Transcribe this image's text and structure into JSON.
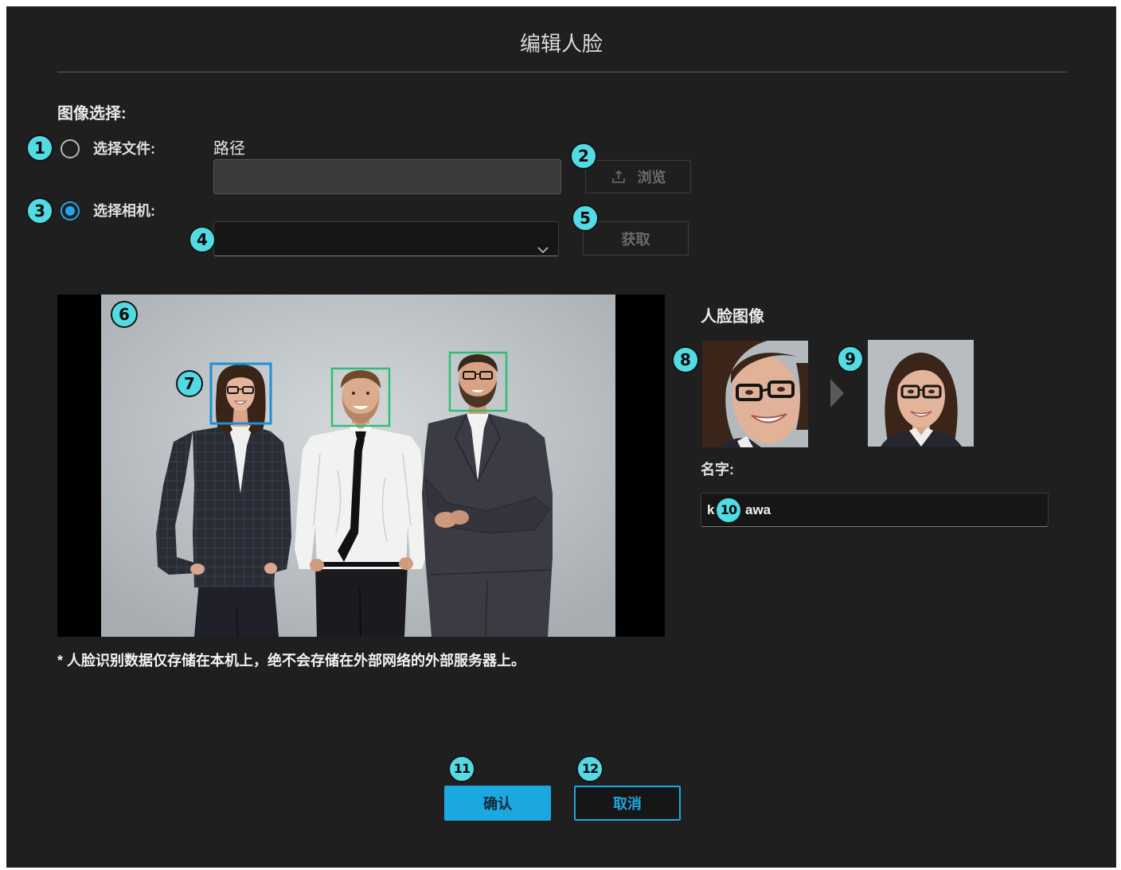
{
  "dialog": {
    "title": "编辑人脸"
  },
  "image_selection": {
    "heading": "图像选择:",
    "file_option": {
      "label": "选择文件:",
      "selected": false
    },
    "path_label": "路径",
    "path_input": {
      "value": ""
    },
    "browse_button": {
      "label": "浏览",
      "icon": "upload-icon",
      "enabled": false
    },
    "camera_option": {
      "label": "选择相机:",
      "selected": true
    },
    "camera_select": {
      "value": "",
      "icon": "chevron-down-icon"
    },
    "acquire_button": {
      "label": "获取",
      "enabled": false
    }
  },
  "preview": {
    "face_boxes": [
      {
        "color": "#1e90d6",
        "selected": true
      },
      {
        "color": "#2fbf74",
        "selected": false
      },
      {
        "color": "#2fbf74",
        "selected": false
      }
    ]
  },
  "face_image": {
    "heading": "人脸图像",
    "arrow_icon": "triangle-right-icon"
  },
  "name_field": {
    "label": "名字:",
    "value_parts": [
      "k",
      "awa"
    ]
  },
  "notice": "* 人脸识别数据仅存储在本机上，绝不会存储在外部网络的外部服务器上。",
  "buttons": {
    "confirm": "确认",
    "cancel": "取消"
  },
  "callouts": [
    "1",
    "2",
    "3",
    "4",
    "5",
    "6",
    "7",
    "8",
    "9",
    "10",
    "11",
    "12"
  ],
  "colors": {
    "panel_bg": "#1f1f1f",
    "accent": "#1ba8e0",
    "callout": "#52dbe4",
    "radio_selected": "#21a6e8"
  }
}
